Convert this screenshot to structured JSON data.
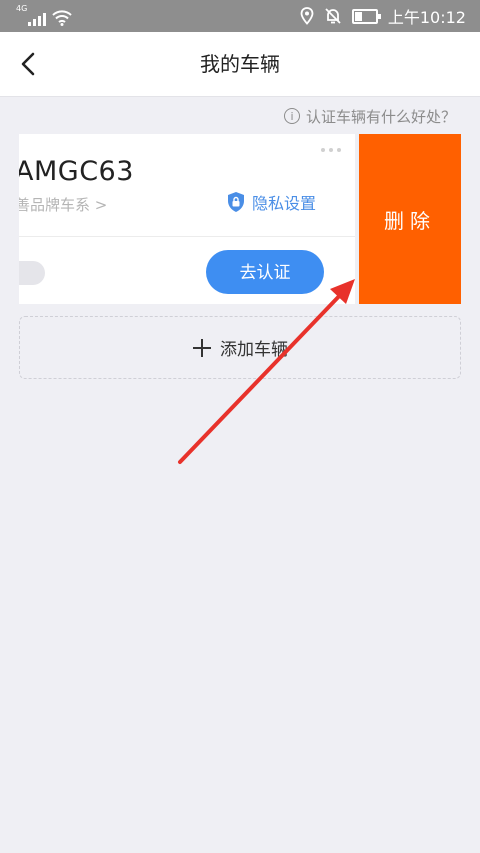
{
  "status_bar": {
    "network": "4G",
    "time": "上午10:12",
    "icons": [
      "signal-icon",
      "wifi-icon",
      "location-icon",
      "bell-muted-icon",
      "battery-icon"
    ]
  },
  "nav": {
    "title": "我的车辆",
    "back_icon": "chevron-left-icon"
  },
  "help": {
    "text": "认证车辆有什么好处？",
    "icon": "info-icon"
  },
  "vehicle_card": {
    "plate": "AMGC63",
    "brand_link": "善品牌车系 >",
    "privacy_label": "隐私设置",
    "certify_button": "去认证",
    "more_icon": "more-dots-icon"
  },
  "delete_action": {
    "label": "删除"
  },
  "add_vehicle": {
    "label": "添加车辆"
  },
  "colors": {
    "delete": "#ff6000",
    "primary": "#3e8ef2",
    "link": "#4a8ee6",
    "annotation": "#e8322b"
  }
}
